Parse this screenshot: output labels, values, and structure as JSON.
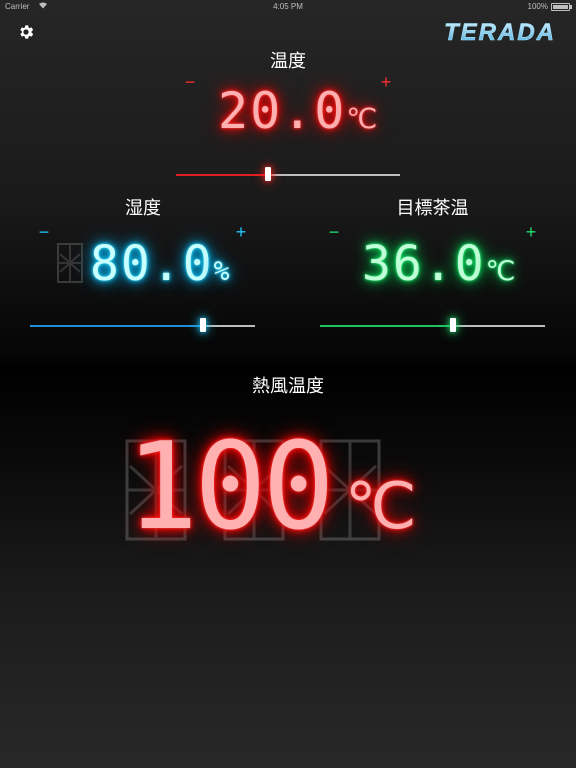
{
  "status_bar": {
    "carrier": "Carrier",
    "time": "4:05 PM",
    "battery": "100%"
  },
  "app": {
    "logo": "TERADA"
  },
  "temperature": {
    "label": "温度",
    "minus": "−",
    "plus": "+",
    "value": "20.0",
    "unit": "℃",
    "slider_fraction": 0.41,
    "color": "#ff2020"
  },
  "humidity": {
    "label": "湿度",
    "minus": "−",
    "plus": "+",
    "value": "80.0",
    "unit": "%",
    "slider_fraction": 0.77,
    "color": "#20c8ff"
  },
  "target_tea_temp": {
    "label": "目標茶温",
    "minus": "−",
    "plus": "+",
    "value": "36.0",
    "unit": "℃",
    "slider_fraction": 0.59,
    "color": "#20e070"
  },
  "hot_air_temp": {
    "label": "熱風温度",
    "value": "100",
    "unit": "℃",
    "color": "#ff2020"
  },
  "icons": {
    "settings": "gear-icon"
  }
}
